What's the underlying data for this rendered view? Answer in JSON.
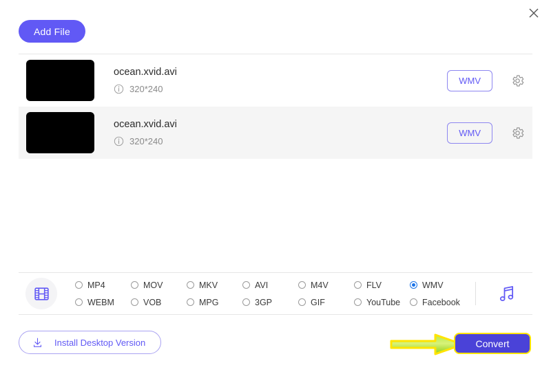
{
  "window": {
    "close_label": "✕"
  },
  "toolbar": {
    "add_file_label": "Add File"
  },
  "file_list": {
    "rows": [
      {
        "name": "ocean.xvid.avi",
        "dimensions": "320*240",
        "format_badge": "WMV",
        "info_icon": "info-icon",
        "settings_icon": "gear-icon",
        "thumbnail": "black-thumbnail"
      },
      {
        "name": "ocean.xvid.avi",
        "dimensions": "320*240",
        "format_badge": "WMV",
        "info_icon": "info-icon",
        "settings_icon": "gear-icon",
        "thumbnail": "black-thumbnail"
      }
    ]
  },
  "format_bar": {
    "video_icon": "film-strip-icon",
    "audio_icon": "music-note-icon",
    "options": [
      {
        "label": "MP4",
        "selected": false
      },
      {
        "label": "MOV",
        "selected": false
      },
      {
        "label": "MKV",
        "selected": false
      },
      {
        "label": "AVI",
        "selected": false
      },
      {
        "label": "M4V",
        "selected": false
      },
      {
        "label": "FLV",
        "selected": false
      },
      {
        "label": "WMV",
        "selected": true
      },
      {
        "label": "WEBM",
        "selected": false
      },
      {
        "label": "VOB",
        "selected": false
      },
      {
        "label": "MPG",
        "selected": false
      },
      {
        "label": "3GP",
        "selected": false
      },
      {
        "label": "GIF",
        "selected": false
      },
      {
        "label": "YouTube",
        "selected": false
      },
      {
        "label": "Facebook",
        "selected": false
      }
    ],
    "selected_format": "WMV"
  },
  "footer": {
    "install_label": "Install Desktop Version",
    "install_icon": "download-icon",
    "convert_label": "Convert",
    "annotation_icon": "yellow-arrow-annotation"
  },
  "colors": {
    "accent_purple": "#6159f5",
    "convert_blue": "#4a42d8",
    "highlight_yellow": "#ffe400",
    "arrow_green": "#9ede1f",
    "radio_selected_blue": "#1a73e8",
    "row_alt_background": "#f5f5f5"
  }
}
